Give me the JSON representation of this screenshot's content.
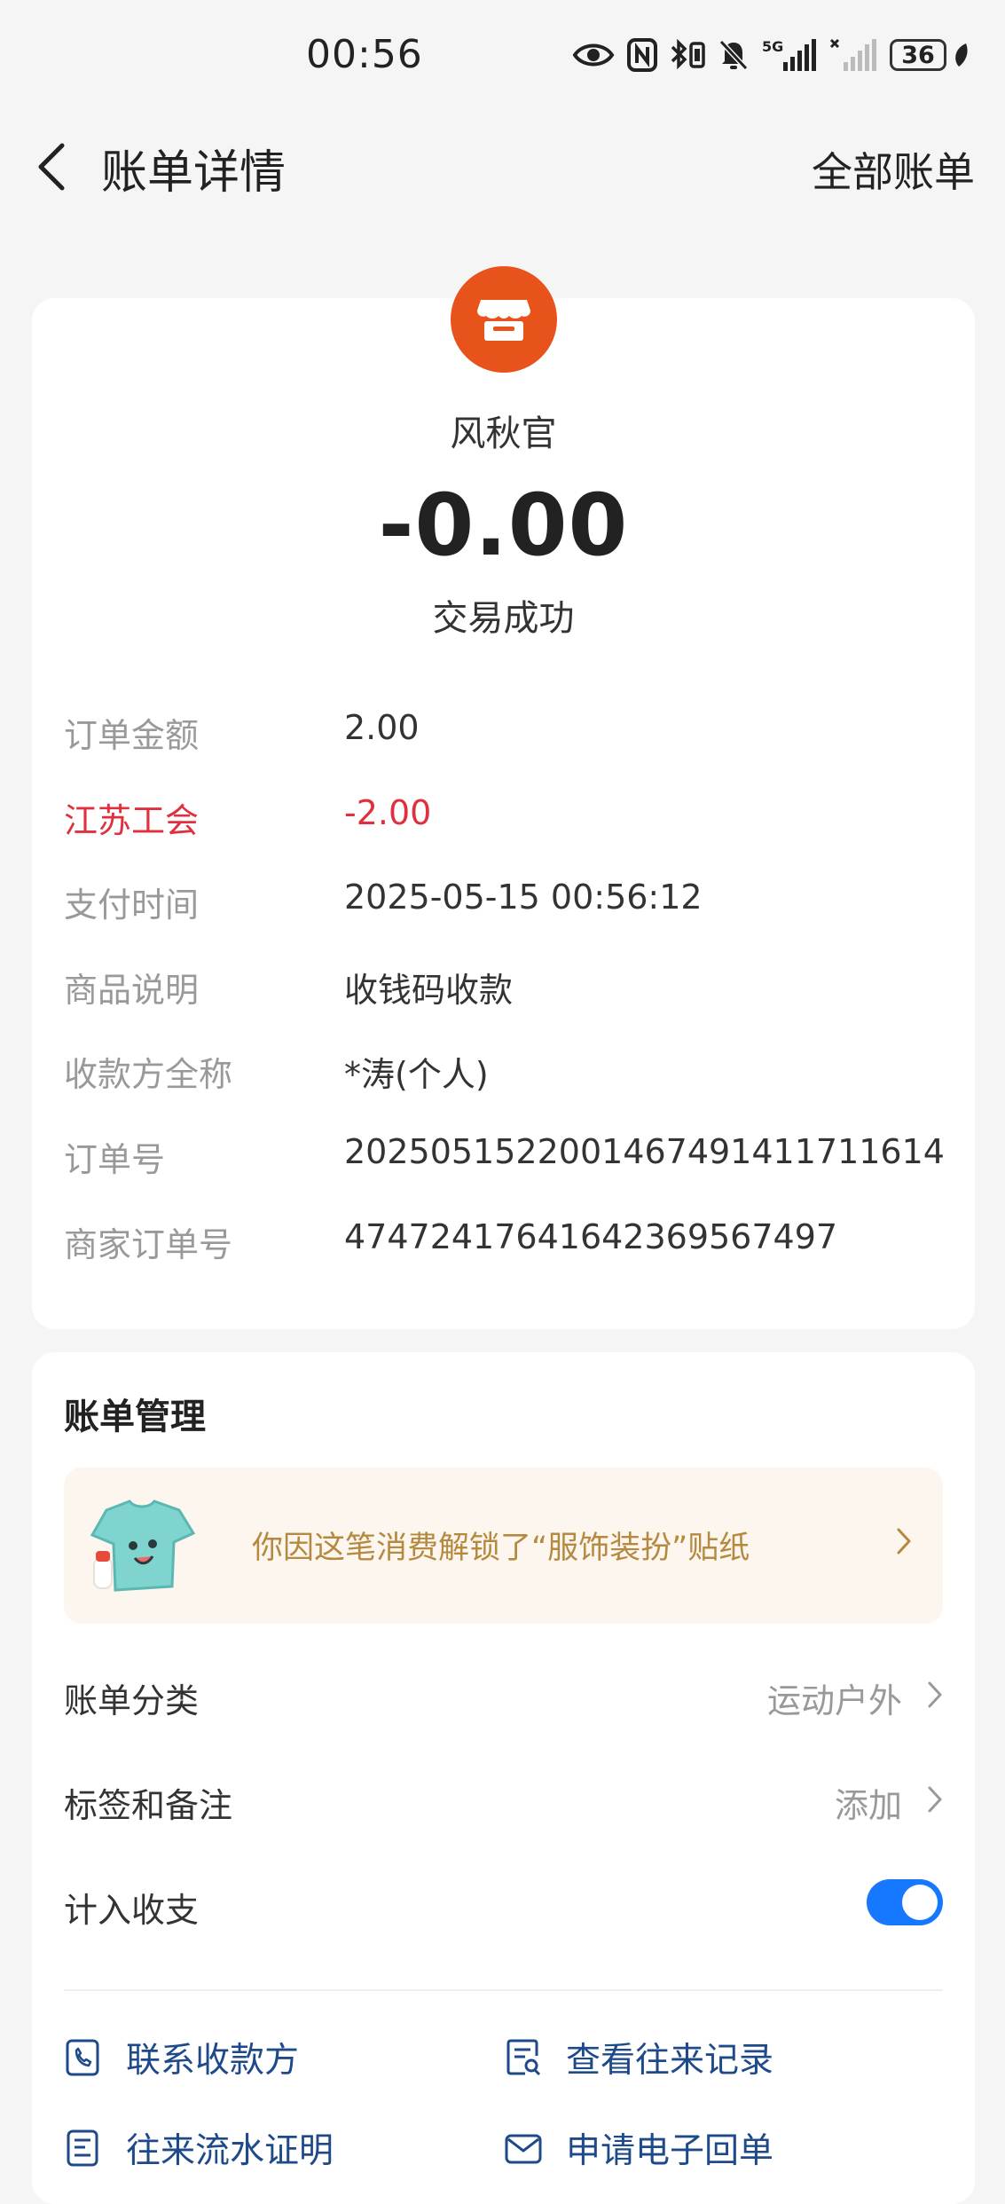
{
  "status_bar": {
    "time": "00:56",
    "network": "5G",
    "battery": "36",
    "icons": [
      "eye-icon",
      "nfc-icon",
      "bluetooth-icon",
      "mute-icon",
      "signal-icon",
      "signal-off-icon",
      "battery-icon",
      "leaf-icon"
    ]
  },
  "nav": {
    "title": "账单详情",
    "right_label": "全部账单",
    "back_icon": "chevron-left-icon"
  },
  "transaction": {
    "merchant": "风秋官",
    "amount": "-0.00",
    "status": "交易成功",
    "merchant_icon": "store-icon",
    "merchant_icon_color": "#e8531c"
  },
  "details": [
    {
      "label": "订单金额",
      "value": "2.00"
    },
    {
      "label": "江苏工会",
      "value": "-2.00"
    },
    {
      "label": "支付时间",
      "value": "2025-05-15 00:56:12"
    },
    {
      "label": "商品说明",
      "value": "收钱码收款"
    },
    {
      "label": "收款方全称",
      "value": "*涛(个人)"
    },
    {
      "label": "订单号",
      "value": "2025051522001467491411711614"
    },
    {
      "label": "商家订单号",
      "value": "47472417641642369567497"
    }
  ],
  "highlight_color": "#e0303e",
  "management": {
    "title": "账单管理",
    "sticker_text": "你因这笔消费解锁了“服饰装扮”贴纸",
    "category": {
      "label": "账单分类",
      "value": "运动户外"
    },
    "tags": {
      "label": "标签和备注",
      "value": "添加"
    },
    "include": {
      "label": "计入收支",
      "enabled": true
    },
    "actions": [
      {
        "label": "联系收款方",
        "icon": "phone-contact-icon"
      },
      {
        "label": "查看往来记录",
        "icon": "record-search-icon"
      },
      {
        "label": "往来流水证明",
        "icon": "statement-icon"
      },
      {
        "label": "申请电子回单",
        "icon": "mail-icon"
      }
    ]
  },
  "colors": {
    "accent": "#1677ff",
    "link": "#1f4a8a",
    "sticker_text": "#b58a40"
  }
}
